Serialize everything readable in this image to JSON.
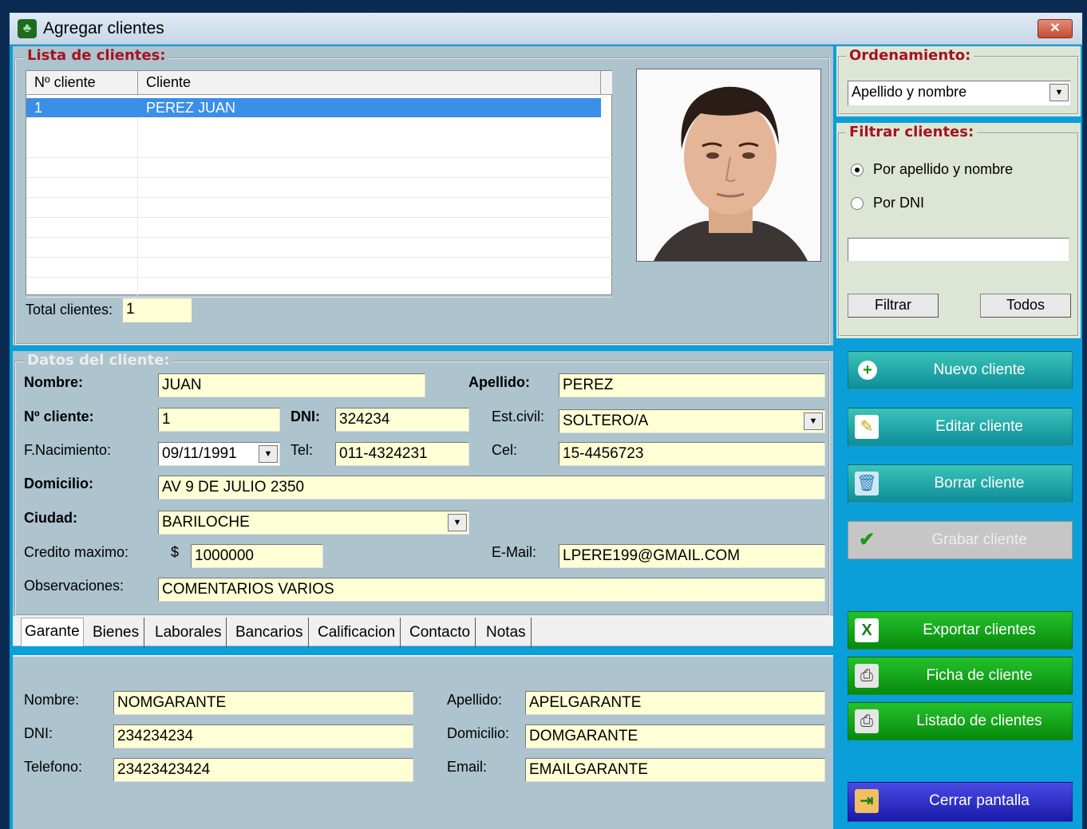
{
  "window": {
    "title": "Agregar clientes",
    "close_label": "✕"
  },
  "list": {
    "legend": "Lista de clientes:",
    "columns": [
      "Nº cliente",
      "Cliente"
    ],
    "rows": [
      {
        "num": "1",
        "name": "PEREZ JUAN"
      }
    ],
    "total_label": "Total clientes:",
    "total_value": "1"
  },
  "sort": {
    "legend": "Ordenamiento:",
    "selected": "Apellido y nombre"
  },
  "filter": {
    "legend": "Filtrar clientes:",
    "option1": "Por apellido y nombre",
    "option2": "Por DNI",
    "selected": "option1",
    "text": "",
    "filter_btn": "Filtrar",
    "all_btn": "Todos"
  },
  "data": {
    "legend": "Datos del cliente:",
    "nombre_label": "Nombre:",
    "nombre": "JUAN",
    "apellido_label": "Apellido:",
    "apellido": "PEREZ",
    "num_label": "Nº cliente:",
    "num": "1",
    "dni_label": "DNI:",
    "dni": "324234",
    "estcivil_label": "Est.civil:",
    "estcivil": "SOLTERO/A",
    "fnac_label": "F.Nacimiento:",
    "fnac": "09/11/1991",
    "tel_label": "Tel:",
    "tel": "011-4324231",
    "cel_label": "Cel:",
    "cel": "15-4456723",
    "domicilio_label": "Domicilio:",
    "domicilio": "AV 9 DE JULIO 2350",
    "ciudad_label": "Ciudad:",
    "ciudad": "BARILOCHE",
    "credito_label": "Credito maximo:",
    "credito_currency": "$",
    "credito": "1000000",
    "email_label": "E-Mail:",
    "email": "LPERE199@GMAIL.COM",
    "obs_label": "Observaciones:",
    "obs": "COMENTARIOS VARIOS"
  },
  "tabs": [
    "Garante",
    "Bienes",
    "Laborales",
    "Bancarios",
    "Calificacion",
    "Contacto",
    "Notas"
  ],
  "garante": {
    "nombre_label": "Nombre:",
    "nombre": "NOMGARANTE",
    "apellido_label": "Apellido:",
    "apellido": "APELGARANTE",
    "dni_label": "DNI:",
    "dni": "234234234",
    "domicilio_label": "Domicilio:",
    "domicilio": "DOMGARANTE",
    "telefono_label": "Telefono:",
    "telefono": "23423423424",
    "email_label": "Email:",
    "email": "EMAILGARANTE"
  },
  "actions": {
    "nuevo": "Nuevo cliente",
    "editar": "Editar cliente",
    "borrar": "Borrar cliente",
    "grabar": "Grabar cliente",
    "exportar": "Exportar clientes",
    "ficha": "Ficha de cliente",
    "listado": "Listado de clientes",
    "cerrar": "Cerrar pantalla"
  },
  "colors": {
    "accent_red": "#a5121f",
    "field_bg": "#ffffd6",
    "selection": "#3a8fe6"
  }
}
